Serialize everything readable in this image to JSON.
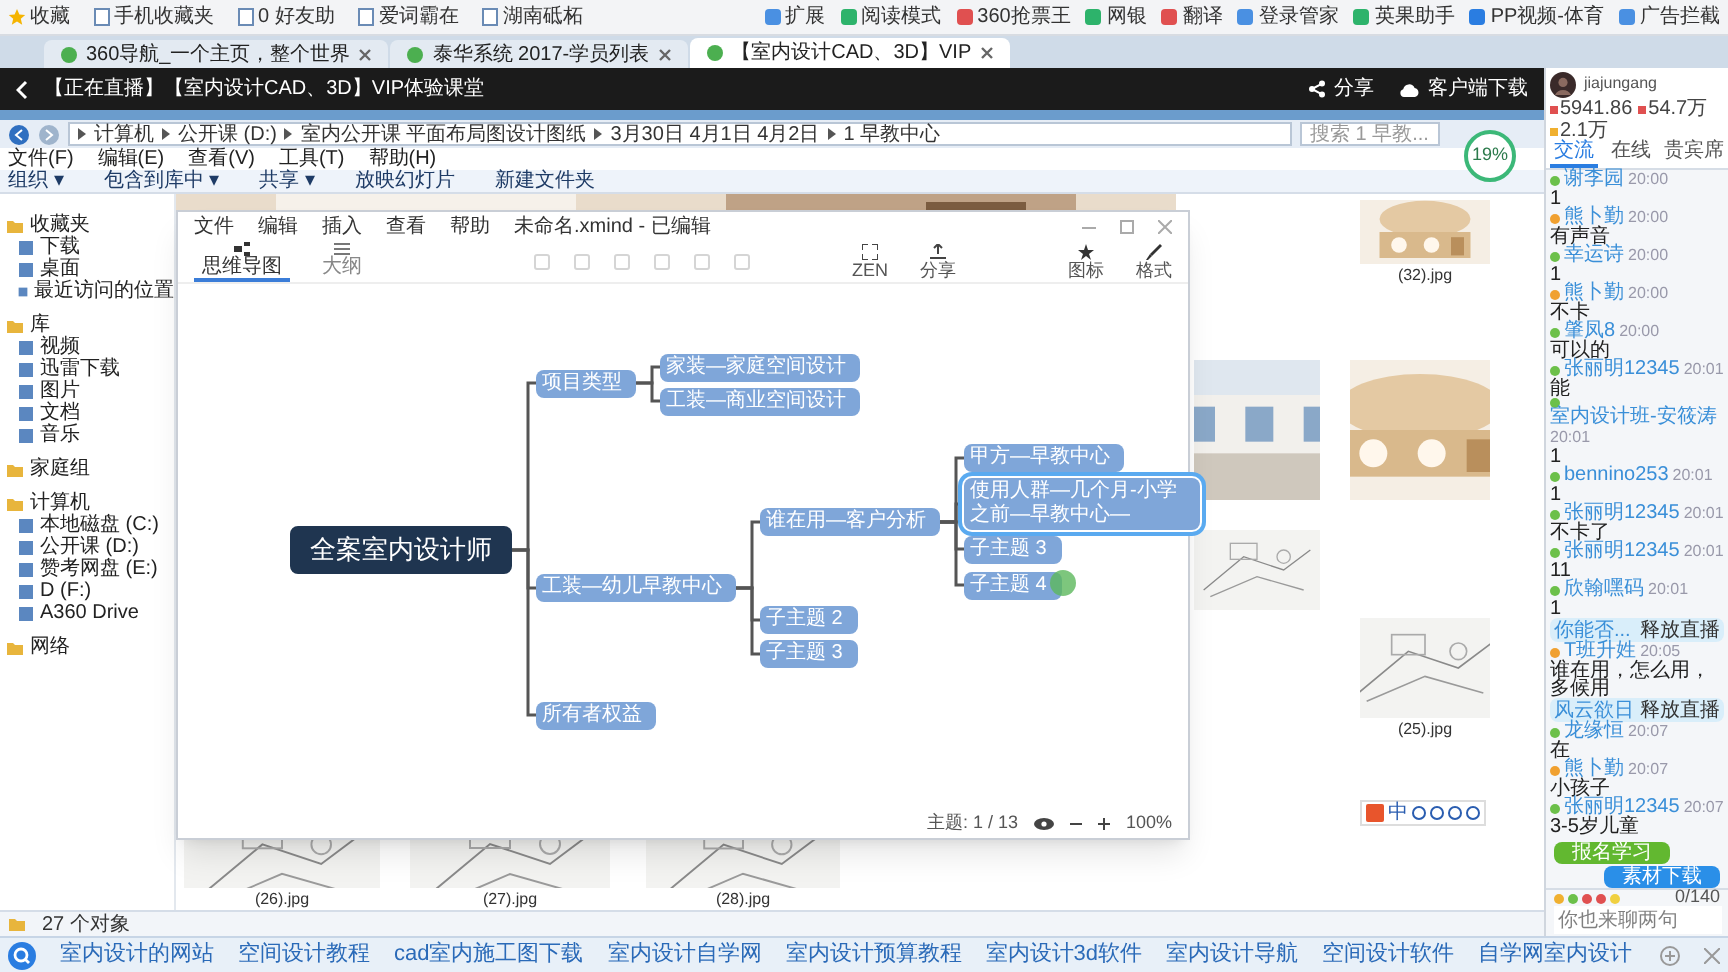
{
  "browser": {
    "bookmarks": [
      "收藏",
      "手机收藏夹",
      "0 好友助",
      "爱词霸在",
      "湖南砥柘"
    ],
    "toolbar_items": [
      "扩展",
      "阅读模式",
      "360抢票王",
      "网银",
      "翻译",
      "登录管家",
      "英果助手",
      "PP视频-体育",
      "广告拦截"
    ],
    "tabs": [
      {
        "title": "360导航_一个主页，整个世界",
        "selected": false
      },
      {
        "title": "泰华系统 2017-学员列表",
        "selected": false
      },
      {
        "title": "【室内设计CAD、3D】VIP",
        "selected": true
      }
    ]
  },
  "live_header": {
    "title": "【正在直播】【室内设计CAD、3D】VIP体验课堂",
    "share": "分享",
    "download": "客户端下载"
  },
  "explorer": {
    "path": [
      "计算机",
      "公开课 (D:)",
      "室内公开课 平面布局图设计图纸",
      "3月30日 4月1日 4月2日",
      "1 早教中心"
    ],
    "search_placeholder": "搜索 1 早教...",
    "network_meter": "19%",
    "menu": [
      "文件(F)",
      "编辑(E)",
      "查看(V)",
      "工具(T)",
      "帮助(H)"
    ],
    "toolbar": [
      "组织 ▾",
      "包含到库中 ▾",
      "共享 ▾",
      "放映幻灯片",
      "新建文件夹"
    ],
    "nav": [
      {
        "label": "收藏夹",
        "kind": "group"
      },
      {
        "label": "下载",
        "kind": "item"
      },
      {
        "label": "桌面",
        "kind": "item"
      },
      {
        "label": "最近访问的位置",
        "kind": "item"
      },
      {
        "label": "库",
        "kind": "group"
      },
      {
        "label": "视频",
        "kind": "item"
      },
      {
        "label": "迅雷下载",
        "kind": "item"
      },
      {
        "label": "图片",
        "kind": "item"
      },
      {
        "label": "文档",
        "kind": "item"
      },
      {
        "label": "音乐",
        "kind": "item"
      },
      {
        "label": "家庭组",
        "kind": "group"
      },
      {
        "label": "计算机",
        "kind": "group"
      },
      {
        "label": "本地磁盘 (C:)",
        "kind": "item"
      },
      {
        "label": "公开课 (D:)",
        "kind": "item"
      },
      {
        "label": "赞考网盘 (E:)",
        "kind": "item"
      },
      {
        "label": "D (F:)",
        "kind": "item"
      },
      {
        "label": "A360 Drive",
        "kind": "item"
      },
      {
        "label": "网络",
        "kind": "group"
      }
    ],
    "files": [
      {
        "name": "(32).jpg"
      },
      {
        "name": "(25).jpg"
      },
      {
        "name": "(26).jpg"
      },
      {
        "name": "(27).jpg"
      },
      {
        "name": "(28).jpg"
      }
    ],
    "status": "27 个对象"
  },
  "mindmap_window": {
    "menu": [
      "文件",
      "编辑",
      "插入",
      "查看",
      "帮助"
    ],
    "filename": "未命名.xmind - 已编辑",
    "view_tabs": [
      {
        "label": "思维导图",
        "selected": true
      },
      {
        "label": "大纲",
        "selected": false
      }
    ],
    "tools": [
      {
        "label": "ZEN",
        "kind": "zen"
      },
      {
        "label": "分享",
        "kind": "share"
      },
      {
        "label": "图标",
        "kind": "star"
      },
      {
        "label": "格式",
        "kind": "brush"
      }
    ],
    "root": {
      "text": "全案室内设计师",
      "selected": false,
      "children": [
        {
          "text": "项目类型",
          "selected": false,
          "children": [
            {
              "text": "家装—家庭空间设计",
              "selected": false
            },
            {
              "text": "工装—商业空间设计",
              "selected": false
            }
          ]
        },
        {
          "text": "工装—幼儿早教中心",
          "selected": false,
          "children": [
            {
              "text": "谁在用—客户分析",
              "selected": false,
              "children": [
                {
                  "text": "甲方—早教中心",
                  "selected": false
                },
                {
                  "text": "使用人群—几个月-小学之前—早教中心—",
                  "selected": true
                },
                {
                  "text": "子主题 3",
                  "selected": false
                },
                {
                  "text": "子主题 4",
                  "selected": false
                }
              ]
            },
            {
              "text": "子主题 2",
              "selected": false
            },
            {
              "text": "子主题 3",
              "selected": false
            }
          ]
        },
        {
          "text": "所有者权益",
          "selected": false
        }
      ]
    },
    "topic_count": "主题: 1 / 13",
    "zoom": "100%"
  },
  "ime_toolbar": {
    "mode": "中"
  },
  "chat": {
    "user": {
      "name": "jiajungang",
      "stats": [
        "5941.86",
        "54.7万",
        "2.1万"
      ]
    },
    "tabs": [
      {
        "label": "交流",
        "selected": true
      },
      {
        "label": "在线",
        "selected": false
      },
      {
        "label": "贵宾席",
        "selected": false
      }
    ],
    "messages": [
      {
        "kind": "message",
        "user": "谢李园",
        "time": "20:00",
        "text": "1",
        "color": "#6cc04a"
      },
      {
        "kind": "message",
        "user": "熊卜勤",
        "time": "20:00",
        "text": "有声音",
        "color": "#f0a030"
      },
      {
        "kind": "message",
        "user": "幸运诗",
        "time": "20:00",
        "text": "1",
        "color": "#6cc04a"
      },
      {
        "kind": "message",
        "user": "熊卜勤",
        "time": "20:00",
        "text": "不卡",
        "color": "#f0a030"
      },
      {
        "kind": "message",
        "user": "肇凤8",
        "time": "20:00",
        "text": "可以的",
        "color": "#6cc04a"
      },
      {
        "kind": "message",
        "user": "张丽明12345",
        "time": "20:01",
        "text": "能",
        "color": "#6cc04a"
      },
      {
        "kind": "message",
        "user": "室内设计班-安筱涛",
        "time": "20:01",
        "text": "1",
        "color": "#6cc04a"
      },
      {
        "kind": "message",
        "user": "bennino253",
        "time": "20:01",
        "text": "1",
        "color": "#6cc04a"
      },
      {
        "kind": "message",
        "user": "张丽明12345",
        "time": "20:01",
        "text": "不卡了",
        "color": "#6cc04a"
      },
      {
        "kind": "message",
        "user": "张丽明12345",
        "time": "20:01",
        "text": "11",
        "color": "#6cc04a"
      },
      {
        "kind": "message",
        "user": "欣翰嘿码",
        "time": "20:01",
        "text": "1",
        "color": "#6cc04a"
      },
      {
        "kind": "banner",
        "user": "你能否...",
        "text": "释放直播"
      },
      {
        "kind": "message",
        "user": "T班升姓",
        "time": "20:05",
        "text": "谁在用，怎么用，多候用",
        "color": "#f0a030"
      },
      {
        "kind": "banner",
        "user": "风云欲日",
        "text": "释放直播"
      },
      {
        "kind": "message",
        "user": "龙缘恒",
        "time": "20:07",
        "text": "在",
        "color": "#6cc04a"
      },
      {
        "kind": "message",
        "user": "熊卜勤",
        "time": "20:07",
        "text": "小孩子",
        "color": "#f0a030"
      },
      {
        "kind": "message",
        "user": "张丽明12345",
        "time": "20:07",
        "text": "3-5岁儿童",
        "color": "#6cc04a"
      }
    ],
    "buttons": [
      "报名学习",
      "素材下载"
    ],
    "counter": "0/140",
    "placeholder": "你也来聊两句"
  },
  "search_bar": {
    "links": [
      "室内设计的网站",
      "空间设计教程",
      "cad室内施工图下载",
      "室内设计自学网",
      "室内设计预算教程",
      "室内设计3d软件",
      "室内设计导航",
      "空间设计软件",
      "自学网室内设计"
    ]
  }
}
